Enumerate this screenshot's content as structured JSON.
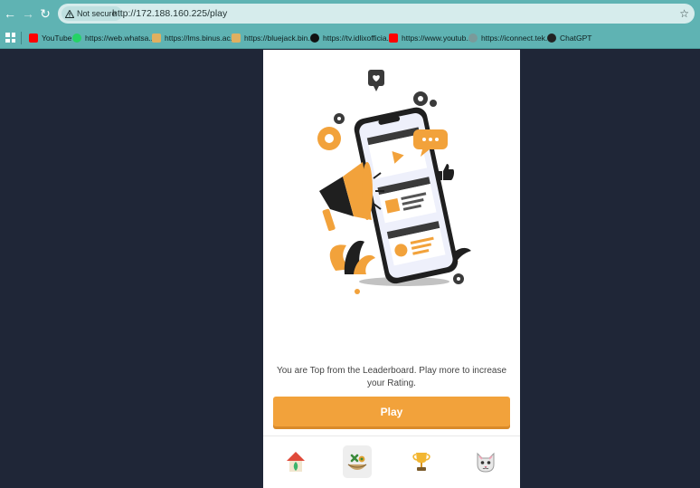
{
  "browser": {
    "security_label": "Not secure",
    "url": "http://172.188.160.225/play",
    "bookmarks": [
      {
        "label": "YouTube",
        "icon": "youtube-icon",
        "color": "#ff0000"
      },
      {
        "label": "https://web.whatsa...",
        "icon": "whatsapp-icon",
        "color": "#25d366"
      },
      {
        "label": "https://lms.binus.ac....",
        "icon": "binus-icon",
        "color": "#e0b060"
      },
      {
        "label": "https://bluejack.bin...",
        "icon": "bluejack-icon",
        "color": "#e0b060"
      },
      {
        "label": "https://tv.idlixofficia...",
        "icon": "idlix-icon",
        "color": "#111111"
      },
      {
        "label": "https://www.youtub...",
        "icon": "youtube-icon",
        "color": "#ff0000"
      },
      {
        "label": "https://iconnect.tek...",
        "icon": "globe-icon",
        "color": "#7a9a9a"
      },
      {
        "label": "ChatGPT",
        "icon": "chatgpt-icon",
        "color": "#222222"
      }
    ]
  },
  "app": {
    "message": "You are Top from the Leaderboard. Play more to increase your Rating.",
    "play_label": "Play",
    "accent_color": "#f2a23b",
    "nav": [
      {
        "icon": "home-icon",
        "active": false
      },
      {
        "icon": "play-game-icon",
        "active": true
      },
      {
        "icon": "trophy-icon",
        "active": false
      },
      {
        "icon": "profile-cat-icon",
        "active": false
      }
    ]
  }
}
